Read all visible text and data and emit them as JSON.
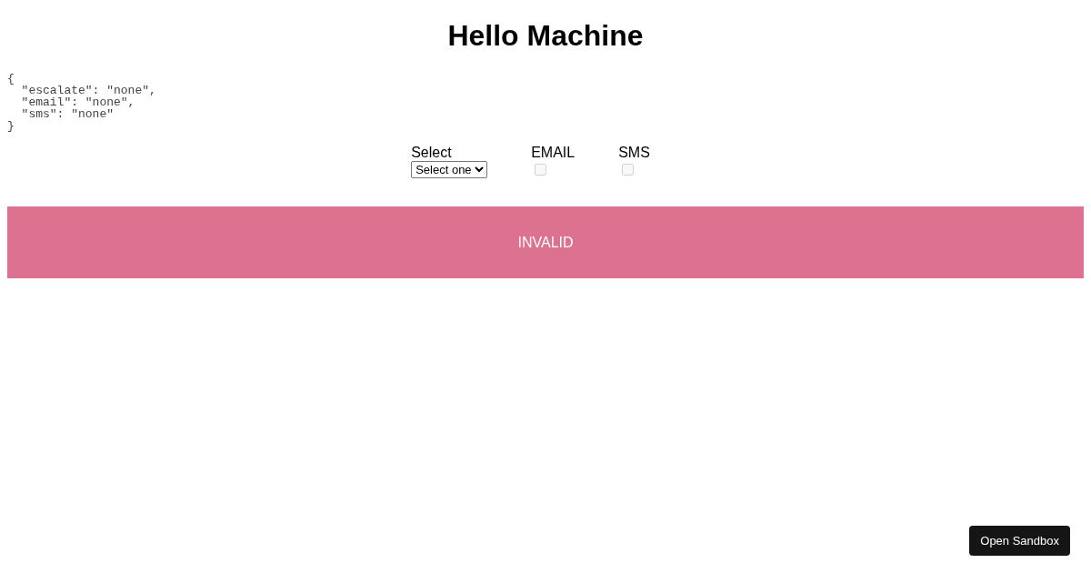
{
  "title": "Hello Machine",
  "json_preview": "{\n  \"escalate\": \"none\",\n  \"email\": \"none\",\n  \"sms\": \"none\"\n}",
  "select": {
    "label": "Select",
    "value": "Select one"
  },
  "options": [
    {
      "label": "EMAIL",
      "checked": false,
      "disabled": true
    },
    {
      "label": "SMS",
      "checked": false,
      "disabled": true
    }
  ],
  "status": {
    "kind": "invalid",
    "text": "INVALID"
  },
  "sandbox_button": {
    "label": "Open Sandbox"
  }
}
